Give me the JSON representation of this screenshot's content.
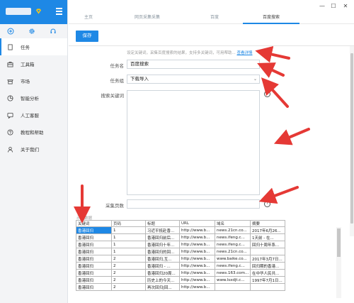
{
  "colors": {
    "accent": "#1e88e5",
    "annotation": "#e53935",
    "sidebar_bg": "#f3f4f6"
  },
  "window": {
    "minimize_glyph": "—",
    "maximize_glyph": "☐",
    "close_glyph": "✕"
  },
  "sidebar": {
    "tool_icons": [
      "plus-circle-icon",
      "gear-icon",
      "headset-icon"
    ],
    "items": [
      {
        "label": "任务",
        "icon": "document-icon",
        "active": true
      },
      {
        "label": "工具箱",
        "icon": "toolbox-icon",
        "active": false
      },
      {
        "label": "市场",
        "icon": "shop-icon",
        "active": false
      },
      {
        "label": "智能分析",
        "icon": "pie-chart-icon",
        "active": false
      },
      {
        "label": "人工客服",
        "icon": "chat-icon",
        "active": false
      },
      {
        "label": "教程和帮助",
        "icon": "help-icon",
        "active": false
      },
      {
        "label": "关于我们",
        "icon": "user-icon",
        "active": false
      }
    ]
  },
  "tabs": [
    {
      "label": "主页",
      "active": false
    },
    {
      "label": "网页采集采集",
      "active": false
    },
    {
      "label": "百度",
      "active": false
    },
    {
      "label": "百度搜索",
      "active": true
    }
  ],
  "toolbar": {
    "save_label": "保存"
  },
  "form": {
    "hint_text": "设定关键词，采集百度搜索的结果，支持多关键词，可用帮助... ",
    "hint_link": "查看详情",
    "task_name_label": "任务名",
    "task_name_value": "百度搜索",
    "task_group_label": "任务组",
    "task_group_value": "下载导入",
    "keywords_label": "搜索关键词",
    "pages_label": "采集页数",
    "help_glyph": "?",
    "select_arrow": "⌄"
  },
  "preview": {
    "label": "示例数据",
    "columns": [
      "关键词",
      "页码",
      "标题",
      "URL",
      "域名",
      "摘要"
    ],
    "rows": [
      [
        "香港回归",
        "1",
        "习近平抵赴香...",
        "http://www.b...",
        "news.21cn.co...",
        "2017年6月26..."
      ],
      [
        "香港回归",
        "1",
        "香港回归前后...",
        "http://www.b...",
        "news.ifeng.c...",
        "1天前 - 在..."
      ],
      [
        "香港回归",
        "1",
        "香港回归十年...",
        "http://www.b...",
        "news.ifeng.c...",
        "回归十周年系..."
      ],
      [
        "香港回归",
        "1",
        "香港回归的回...",
        "http://www.b...",
        "news.21cn.co...",
        ""
      ],
      [
        "香港回归",
        "2",
        "香港回归,互...",
        "http://www.b...",
        "www.baike.co...",
        "2017年3月7日..."
      ],
      [
        "香港回归",
        "2",
        "香港回归 - ...",
        "http://www.b...",
        "news.ifeng.c...",
        "回归期的香港..."
      ],
      [
        "香港回归",
        "2",
        "香港回归20周...",
        "http://www.b...",
        "news.163.com...",
        "在中华人民共..."
      ],
      [
        "香港回归",
        "2",
        "历史上的今天...",
        "http://www.b...",
        "www.lsxdjt.c...",
        "1997年7月1日..."
      ],
      [
        "香港回归",
        "2",
        "再次回归|回...",
        "http://www.b...",
        "",
        ""
      ]
    ]
  }
}
